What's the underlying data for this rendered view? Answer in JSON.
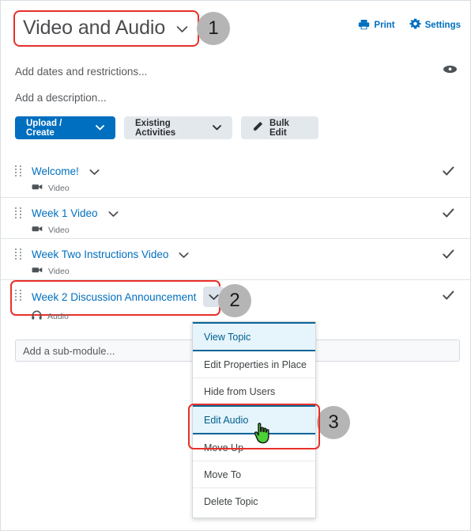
{
  "header": {
    "title": "Video and Audio",
    "title_chevron_icon": "chevron-down-icon",
    "print_label": "Print",
    "print_icon": "printer-icon",
    "settings_label": "Settings",
    "settings_icon": "gear-icon",
    "link_color": "#006fbf"
  },
  "meta": {
    "dates_placeholder": "Add dates and restrictions...",
    "description_placeholder": "Add a description...",
    "visibility_icon": "eye-icon"
  },
  "toolbar": {
    "upload_create_label": "Upload / Create",
    "upload_create_chevron": "chevron-down-icon",
    "existing_activities_label": "Existing Activities",
    "existing_activities_chevron": "chevron-down-icon",
    "bulk_edit_label": "Bulk Edit",
    "bulk_edit_icon": "pencil-icon",
    "primary_color": "#006fbf",
    "secondary_color": "#e3e8ed"
  },
  "topics": [
    {
      "title": "Welcome!",
      "type": "Video",
      "type_icon": "video-camera-icon",
      "status_icon": "checkmark-icon"
    },
    {
      "title": "Week 1 Video",
      "type": "Video",
      "type_icon": "video-camera-icon",
      "status_icon": "checkmark-icon"
    },
    {
      "title": "Week Two Instructions Video",
      "type": "Video",
      "type_icon": "video-camera-icon",
      "status_icon": "checkmark-icon"
    },
    {
      "title": "Week 2 Discussion Announcement",
      "type": "Audio",
      "type_icon": "headphones-icon",
      "status_icon": "checkmark-icon"
    }
  ],
  "submodule": {
    "placeholder": "Add a sub-module..."
  },
  "context_menu": {
    "items": [
      {
        "label": "View Topic",
        "selected": true
      },
      {
        "label": "Edit Properties in Place",
        "selected": false
      },
      {
        "label": "Hide from Users",
        "selected": false
      },
      {
        "label": "Edit Audio",
        "selected": true
      },
      {
        "label": "Move Up",
        "selected": false
      },
      {
        "label": "Move To",
        "selected": false
      },
      {
        "label": "Delete Topic",
        "selected": false
      }
    ]
  },
  "annotations": {
    "badge_1": "1",
    "badge_2": "2",
    "badge_3": "3",
    "highlight_color": "#e8302a",
    "badge_color": "#b5b5b5",
    "cursor_icon": "pointing-hand-cursor"
  }
}
